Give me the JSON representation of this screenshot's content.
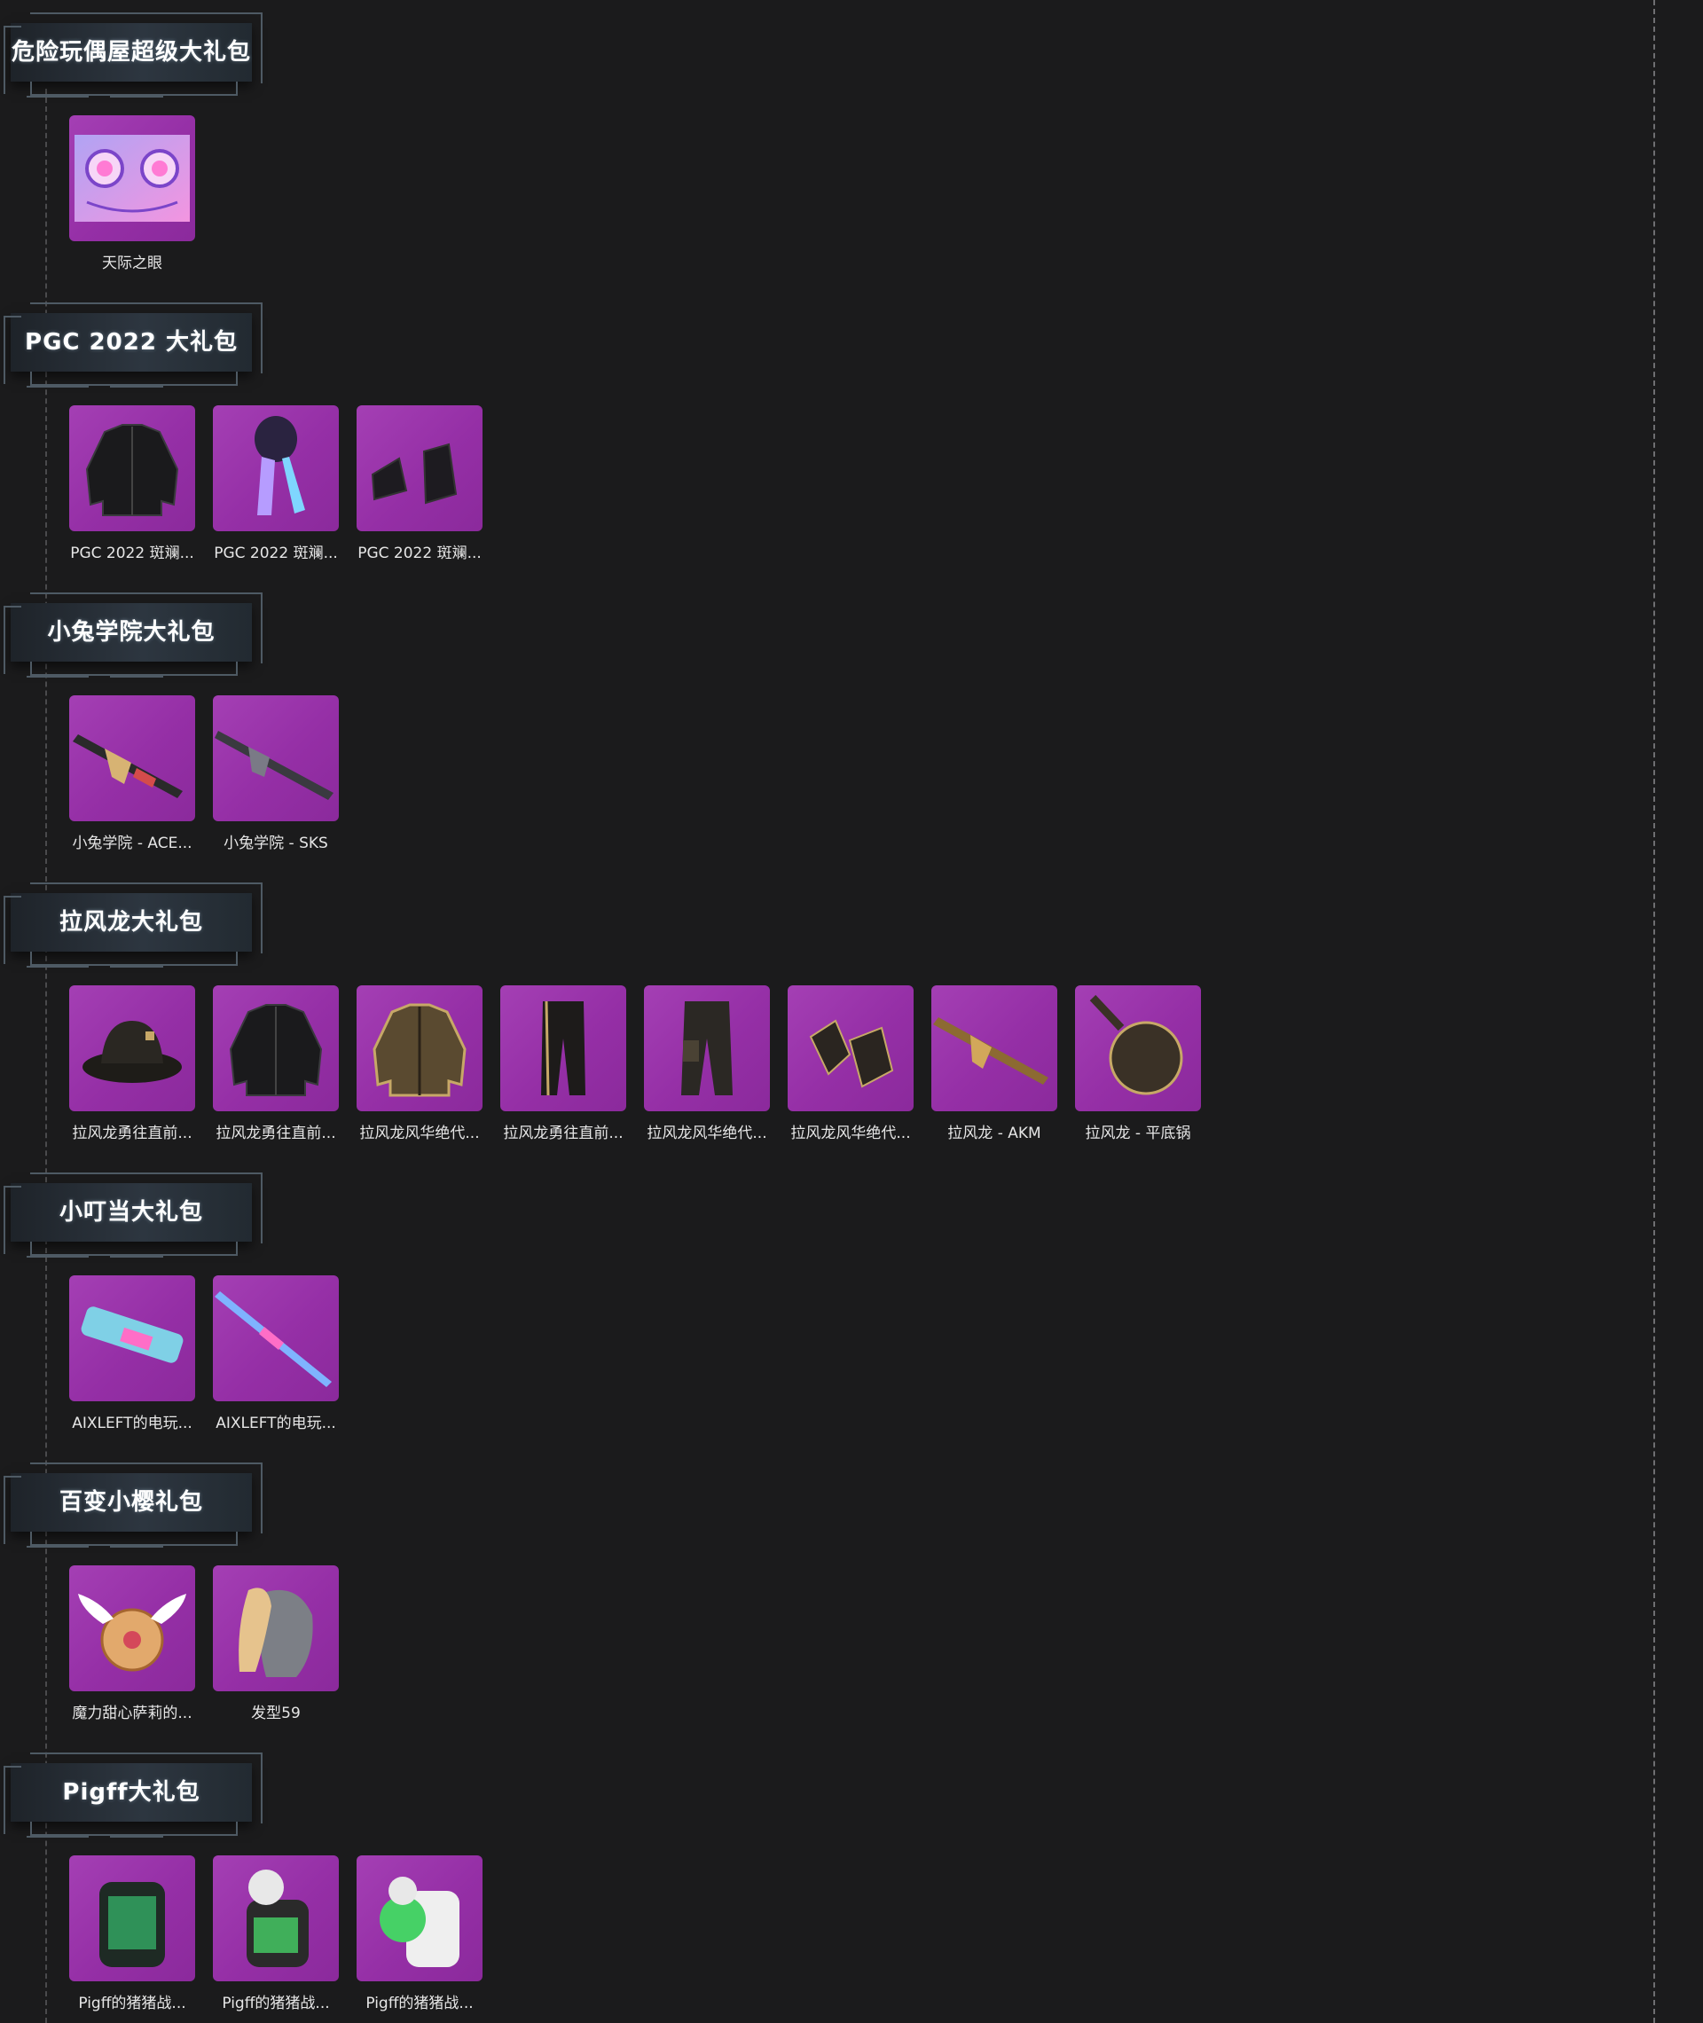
{
  "sections": [
    {
      "title": "危险玩偶屋超级大礼包",
      "items": [
        {
          "label": "天际之眼",
          "icon": "poster-eyes-icon"
        }
      ]
    },
    {
      "title": "PGC 2022 大礼包",
      "items": [
        {
          "label": "PGC 2022 斑斓...",
          "icon": "jacket-icon"
        },
        {
          "label": "PGC 2022 斑斓...",
          "icon": "hood-scarf-icon"
        },
        {
          "label": "PGC 2022 斑斓...",
          "icon": "boots-icon"
        }
      ]
    },
    {
      "title": "小兔学院大礼包",
      "items": [
        {
          "label": "小兔学院 - ACE...",
          "icon": "assault-rifle-icon"
        },
        {
          "label": "小兔学院 - SKS",
          "icon": "marksman-rifle-icon"
        }
      ]
    },
    {
      "title": "拉风龙大礼包",
      "items": [
        {
          "label": "拉风龙勇往直前...",
          "icon": "bucket-hat-icon"
        },
        {
          "label": "拉风龙勇往直前...",
          "icon": "jacket-icon"
        },
        {
          "label": "拉风龙风华绝代...",
          "icon": "gold-jacket-icon"
        },
        {
          "label": "拉风龙勇往直前...",
          "icon": "pants-icon"
        },
        {
          "label": "拉风龙风华绝代...",
          "icon": "cargo-pants-icon"
        },
        {
          "label": "拉风龙风华绝代...",
          "icon": "gloves-icon"
        },
        {
          "label": "拉风龙 - AKM",
          "icon": "akm-rifle-icon"
        },
        {
          "label": "拉风龙 - 平底锅",
          "icon": "frying-pan-icon"
        }
      ]
    },
    {
      "title": "小叮当大礼包",
      "items": [
        {
          "label": "AIXLEFT的电玩...",
          "icon": "smg-icon"
        },
        {
          "label": "AIXLEFT的电玩...",
          "icon": "sniper-rifle-icon"
        }
      ]
    },
    {
      "title": "百变小樱礼包",
      "items": [
        {
          "label": "魔力甜心萨莉的...",
          "icon": "winged-backpack-icon"
        },
        {
          "label": "发型59",
          "icon": "hairstyle-icon"
        }
      ]
    },
    {
      "title": "Pigff大礼包",
      "items": [
        {
          "label": "Pigff的猪猪战...",
          "icon": "backpack-icon"
        },
        {
          "label": "Pigff的猪猪战...",
          "icon": "pig-backpack-icon"
        },
        {
          "label": "Pigff的猪猪战...",
          "icon": "pig-backpack-white-icon"
        }
      ]
    }
  ],
  "colors": {
    "background": "#1b1b1c",
    "tile": "#9b33ad",
    "header_plate": "#2d3640",
    "frame_line": "#4e5a64",
    "label_text": "#e6e6e6"
  }
}
